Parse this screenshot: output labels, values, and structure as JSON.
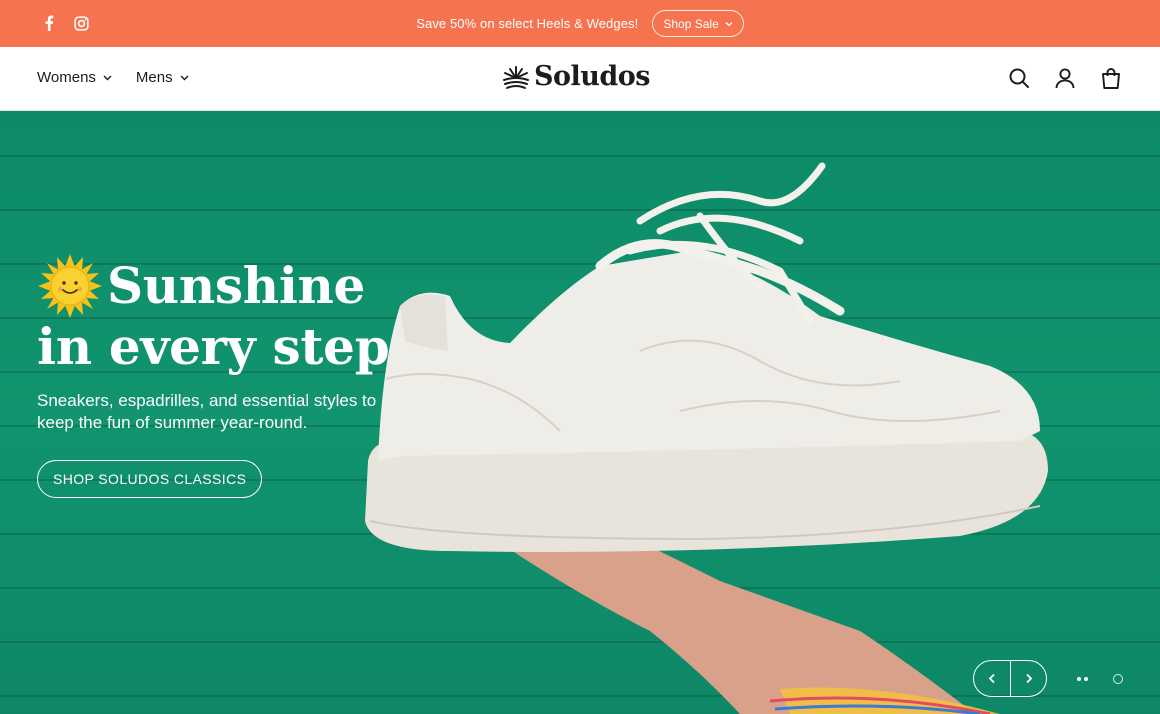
{
  "announcement": {
    "message": "Save 50% on select Heels & Wedges!",
    "button_label": "Shop Sale",
    "background_color": "#f6734f",
    "social_icons": [
      "facebook-icon",
      "instagram-icon"
    ]
  },
  "header": {
    "nav": [
      {
        "label": "Womens"
      },
      {
        "label": "Mens"
      }
    ],
    "logo_text": "Soludos",
    "icons": [
      "search-icon",
      "account-icon",
      "cart-icon"
    ]
  },
  "hero": {
    "headline_line1": "Sunshine",
    "headline_line2": "in every step",
    "subtext": "Sneakers, espadrilles, and essential styles to keep the fun of summer year-round.",
    "cta_label": "SHOP SOLUDOS CLASSICS",
    "background_color": "#0f8e6a",
    "slides_total": 2,
    "active_slide": 1
  }
}
